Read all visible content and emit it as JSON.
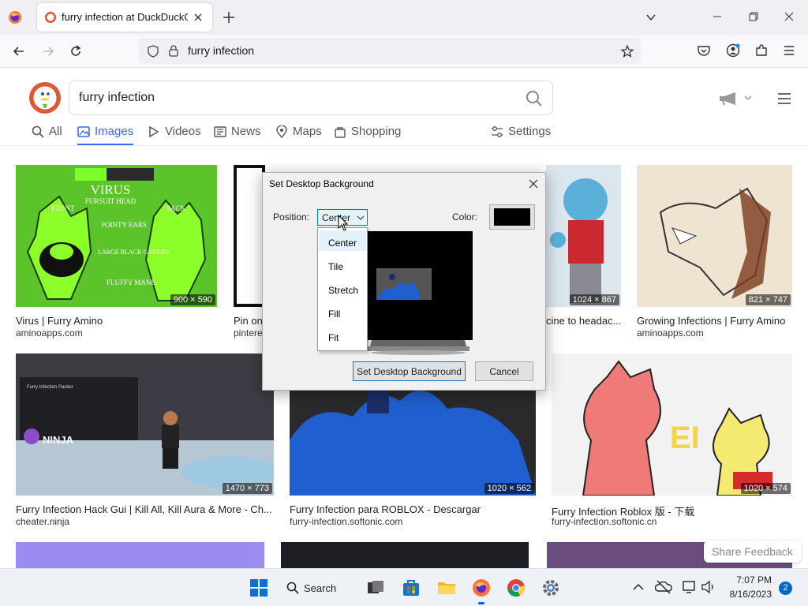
{
  "browser": {
    "tab_title": "furry infection at DuckDuckGo",
    "url": "furry infection"
  },
  "ddg": {
    "query": "furry infection",
    "tabs": [
      {
        "label": "All",
        "icon": "search-icon"
      },
      {
        "label": "Images",
        "icon": "image-icon"
      },
      {
        "label": "Videos",
        "icon": "play-icon"
      },
      {
        "label": "News",
        "icon": "newspaper-icon"
      },
      {
        "label": "Maps",
        "icon": "map-pin-icon"
      },
      {
        "label": "Shopping",
        "icon": "shopping-bag-icon"
      }
    ],
    "settings_label": "Settings"
  },
  "results": [
    {
      "title": "Virus | Furry Amino",
      "domain": "aminoapps.com",
      "dims": "900 × 590",
      "bg": "#5bc42a"
    },
    {
      "title": "Pin on",
      "domain": "pintere",
      "dims": "",
      "bg": "#ffffff"
    },
    {
      "title": "cine to headac...",
      "domain": "",
      "dims": "1024 × 867",
      "bg": "#dbe6ef"
    },
    {
      "title": "Growing Infections | Furry Amino",
      "domain": "aminoapps.com",
      "dims": "821 × 747",
      "bg": "#efe3d2"
    },
    {
      "title": "Furry Infection Hack Gui | Kill All, Kill Aura & More - Ch...",
      "domain": "cheater.ninja",
      "dims": "1470 × 773",
      "bg": "#2f3036"
    },
    {
      "title": "Furry Infection para ROBLOX - Descargar",
      "domain": "furry-infection.softonic.com",
      "dims": "1020 × 562",
      "bg": "#2a2a2c"
    },
    {
      "title": "Furry Infection Roblox 版 - 下载",
      "domain": "furry-infection.softonic.cn",
      "dims": "1020 × 574",
      "bg": "#f2f2f2"
    }
  ],
  "image_text": {
    "virus": "VIRUS",
    "fursuit": "FURSUIT HEAD",
    "front": "FRONT",
    "back": "BACK",
    "pointy": "POINTY EARS",
    "gauges": "LARGE BLACK GAUGES",
    "fluffy": "FLUFFY MANE",
    "ninja": "NINJA",
    "packer": "Furry Infection Packer",
    "ei": "EI"
  },
  "dialog": {
    "title": "Set Desktop Background",
    "position_label": "Position:",
    "position_value": "Center",
    "color_label": "Color:",
    "options": [
      "Center",
      "Tile",
      "Stretch",
      "Fill",
      "Fit"
    ],
    "set_button": "Set Desktop Background",
    "cancel_button": "Cancel"
  },
  "share_feedback": "Share Feedback",
  "taskbar": {
    "search_label": "Search",
    "time": "7:07 PM",
    "date": "8/16/2023",
    "notification_count": "2"
  }
}
